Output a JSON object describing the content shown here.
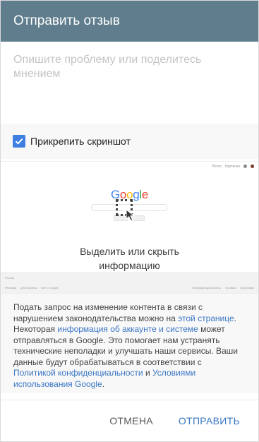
{
  "header": {
    "title": "Отправить отзыв"
  },
  "description": {
    "placeholder": "Опишите проблему или поделитесь мнением"
  },
  "attach": {
    "label": "Прикрепить скриншот",
    "checked": true
  },
  "preview": {
    "top_links": [
      "Почта",
      "Картинки"
    ],
    "logo": [
      "G",
      "o",
      "o",
      "g",
      "l",
      "e"
    ],
    "logo_colors": [
      "#4285f4",
      "#ea4335",
      "#fbbc05",
      "#4285f4",
      "#34a853",
      "#ea4335"
    ],
    "hint": "Выделить или скрыть информацию",
    "footer_country": "Россия",
    "footer_left": [
      "Реклама",
      "Для бизнеса",
      "Всё о Google"
    ],
    "footer_right": [
      "Конфиденциальность",
      "Условия",
      "Настройки"
    ]
  },
  "legal": {
    "t1": "Подать запрос на изменение контента в связи с нарушением законодательства можно на ",
    "l1": "этой странице",
    "t2": ". Некоторая ",
    "l2": "информация об аккаунте и системе",
    "t3": " может отправляться в Google. Это помогает нам устранять технические неполадки и улучшать наши сервисы. Ваши данные будут обрабатываться в соответствии с ",
    "l3": "Политикой конфиденциальности",
    "t4": " и ",
    "l4": "Условиями использования Google",
    "t5": "."
  },
  "footer": {
    "cancel": "ОТМЕНА",
    "send": "ОТПРАВИТЬ"
  },
  "colors": {
    "header": "#5f7d8c",
    "accent": "#3a76c4",
    "checkbox": "#3f7fe0"
  }
}
